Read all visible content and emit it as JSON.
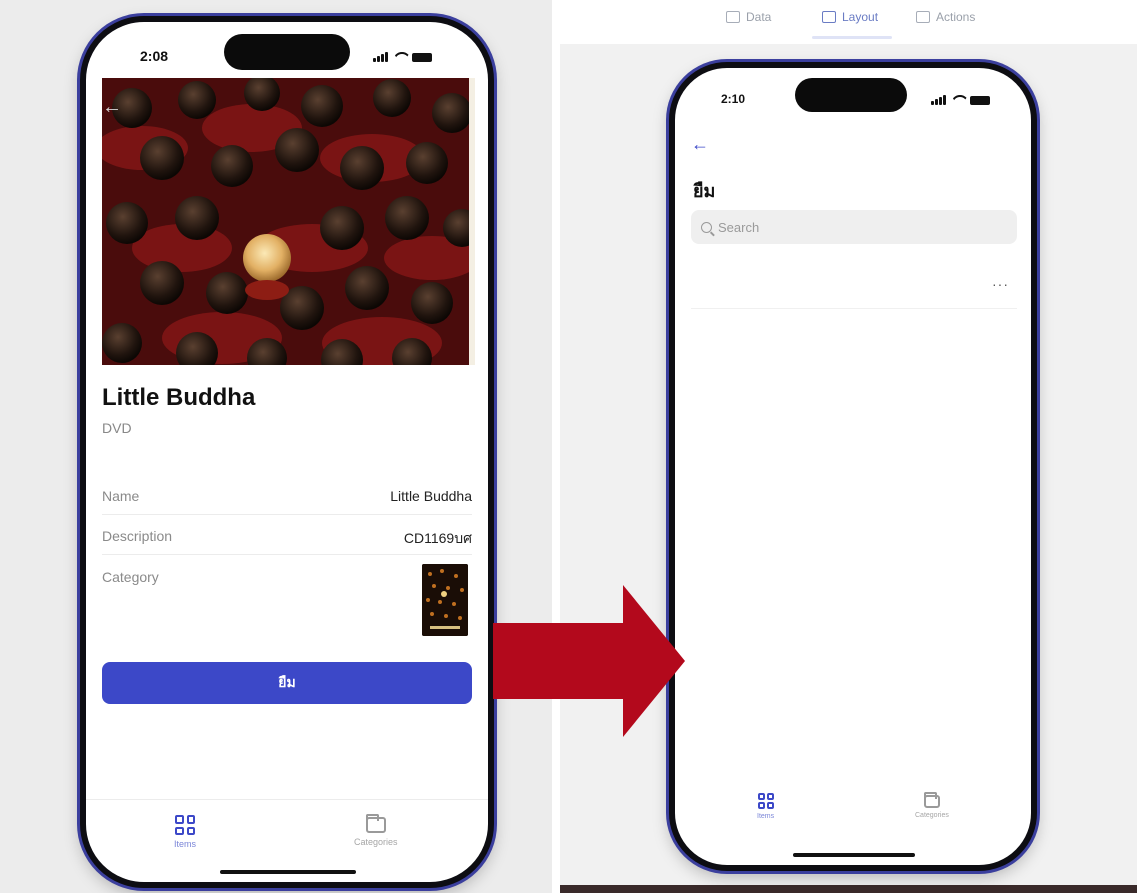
{
  "colors": {
    "accent": "#3c48c8",
    "phone_frame": "#3b3f9e",
    "arrow": "#b3091c"
  },
  "editor_toolbar": {
    "items": [
      {
        "label": "Data",
        "icon": "database-icon"
      },
      {
        "label": "Layout",
        "icon": "layout-icon"
      },
      {
        "label": "Actions",
        "icon": "actions-icon"
      }
    ],
    "active": "Layout"
  },
  "detail_screen": {
    "status": {
      "time": "2:08"
    },
    "title": "Little Buddha",
    "subtitle": "DVD",
    "fields": [
      {
        "label": "Name",
        "value": "Little Buddha"
      },
      {
        "label": "Description",
        "value": "CD1169บศ"
      },
      {
        "label": "Category",
        "value": ""
      }
    ],
    "cta_label": "ยืม",
    "tabs": [
      {
        "label": "Items",
        "icon": "grid-icon",
        "active": true
      },
      {
        "label": "Categories",
        "icon": "folder-icon",
        "active": false
      }
    ]
  },
  "list_screen": {
    "status": {
      "time": "2:10"
    },
    "title": "ยืม",
    "search_placeholder": "Search",
    "more_label": "···",
    "tabs": [
      {
        "label": "Items",
        "icon": "grid-icon",
        "active": true
      },
      {
        "label": "Categories",
        "icon": "folder-icon",
        "active": false
      }
    ]
  }
}
